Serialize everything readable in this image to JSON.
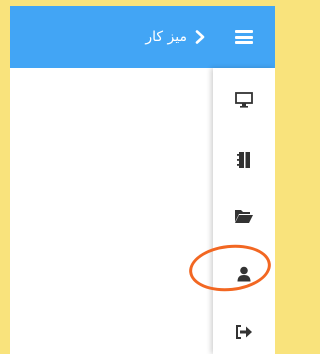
{
  "header": {
    "title": "میز کار",
    "background": "#42a5f5"
  },
  "sidebar": {
    "items": [
      {
        "icon": "monitor-icon"
      },
      {
        "icon": "book-icon"
      },
      {
        "icon": "folder-open-icon"
      },
      {
        "icon": "user-icon",
        "highlighted": true
      },
      {
        "icon": "sign-out-icon"
      }
    ]
  },
  "annotation": {
    "color": "#f26722"
  }
}
